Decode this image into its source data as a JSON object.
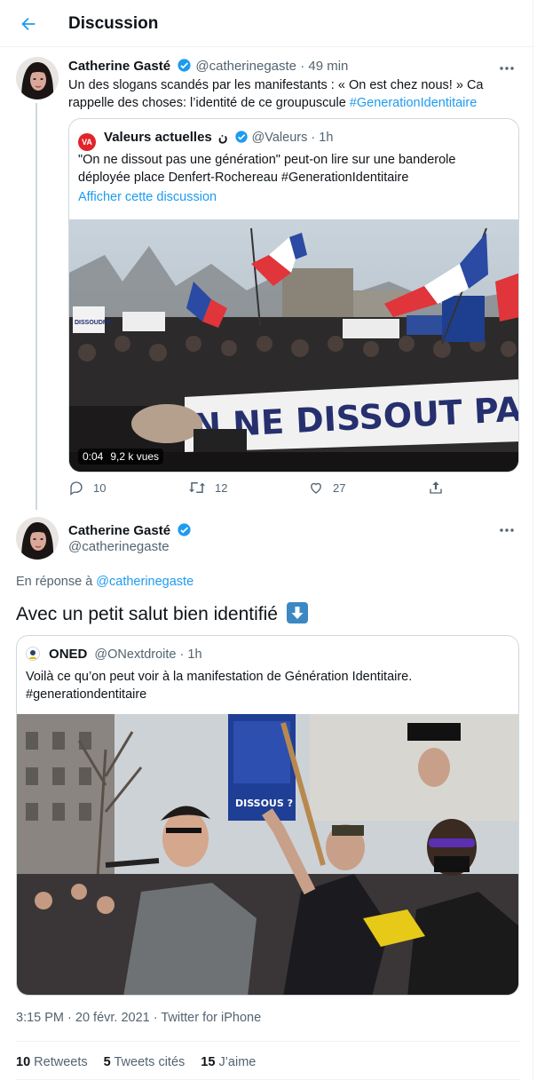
{
  "header": {
    "title": "Discussion",
    "back_icon": "arrow-left-icon"
  },
  "colors": {
    "accent": "#1d9bf0",
    "muted": "#536471",
    "border": "#cfd9de"
  },
  "tweet1": {
    "author_name": "Catherine Gasté",
    "handle": "@catherinegaste",
    "separator": "·",
    "time": "49 min",
    "text_plain": "Un des slogans scandés par les manifestants : « On est chez nous! » Ca rappelle des choses: l’identité de ce groupuscule ",
    "text_hashtag": "#GenerationIdentitaire",
    "quote": {
      "author_name": "Valeurs actuelles",
      "logo_text": "VA",
      "name_suffix": "ن",
      "handle": "@Valeurs",
      "separator": "·",
      "time": "1h",
      "text": "\"On ne dissout pas une génération\" peut-on lire sur une banderole déployée place Denfert-Rochereau #GenerationIdentitaire",
      "show_thread": "Afficher cette discussion",
      "video_duration": "0:04",
      "video_views": "9,2 k vues",
      "banner_text": "N NE DISSOUT PAS UN",
      "sign_left": "DISSOUDRE"
    },
    "actions": {
      "replies": "10",
      "retweets": "12",
      "likes": "27"
    }
  },
  "tweet2": {
    "author_name": "Catherine Gasté",
    "handle": "@catherinegaste",
    "reply_prefix": "En réponse à ",
    "reply_handle": "@catherinegaste",
    "text": "Avec un petit salut bien identifié",
    "emoji": "down-arrow-emoji",
    "quote": {
      "author_name": "ONED",
      "handle": "@ONextdroite",
      "separator": "·",
      "time": "1h",
      "text_line1": "Voilà ce qu’on peut voir à la manifestation de Génération Identitaire.",
      "text_line2": "#generationdentitaire",
      "sign_text": "DISSOUS ?"
    },
    "timestamp": "3:15 PM · 20 févr. 2021 · Twitter for iPhone",
    "stats": [
      {
        "count": "10",
        "label": "Retweets"
      },
      {
        "count": "5",
        "label": "Tweets cités"
      },
      {
        "count": "15",
        "label": "J’aime"
      }
    ]
  }
}
